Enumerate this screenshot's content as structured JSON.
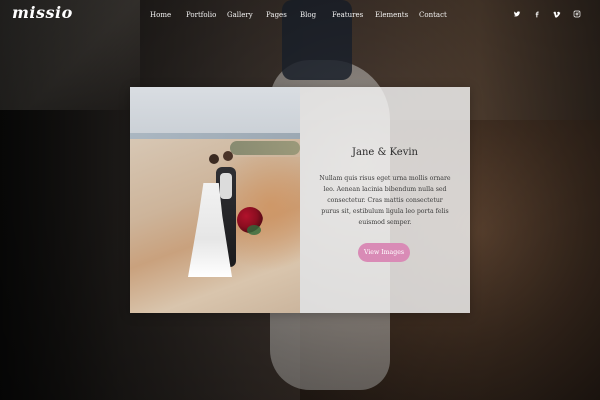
{
  "header": {
    "logo_text": "missio",
    "nav": [
      "Home",
      "Portfolio",
      "Gallery",
      "Pages",
      "Blog",
      "Features",
      "Elements",
      "Contact"
    ],
    "social_icons": [
      "twitter-icon",
      "facebook-icon",
      "vimeo-icon",
      "instagram-icon"
    ]
  },
  "card": {
    "title": "Jane & Kevin",
    "description": "Nullam quis risus eget urna mollis ornare leo. Aenean lacinia bibendum nulla sed consectetur. Cras mattis consectetur purus sit, estibulum ligula leo porta felis euismod semper.",
    "button_label": "View Images"
  },
  "colors": {
    "accent_pink": "#d98bb6",
    "card_overlay": "#f5f5f5"
  }
}
